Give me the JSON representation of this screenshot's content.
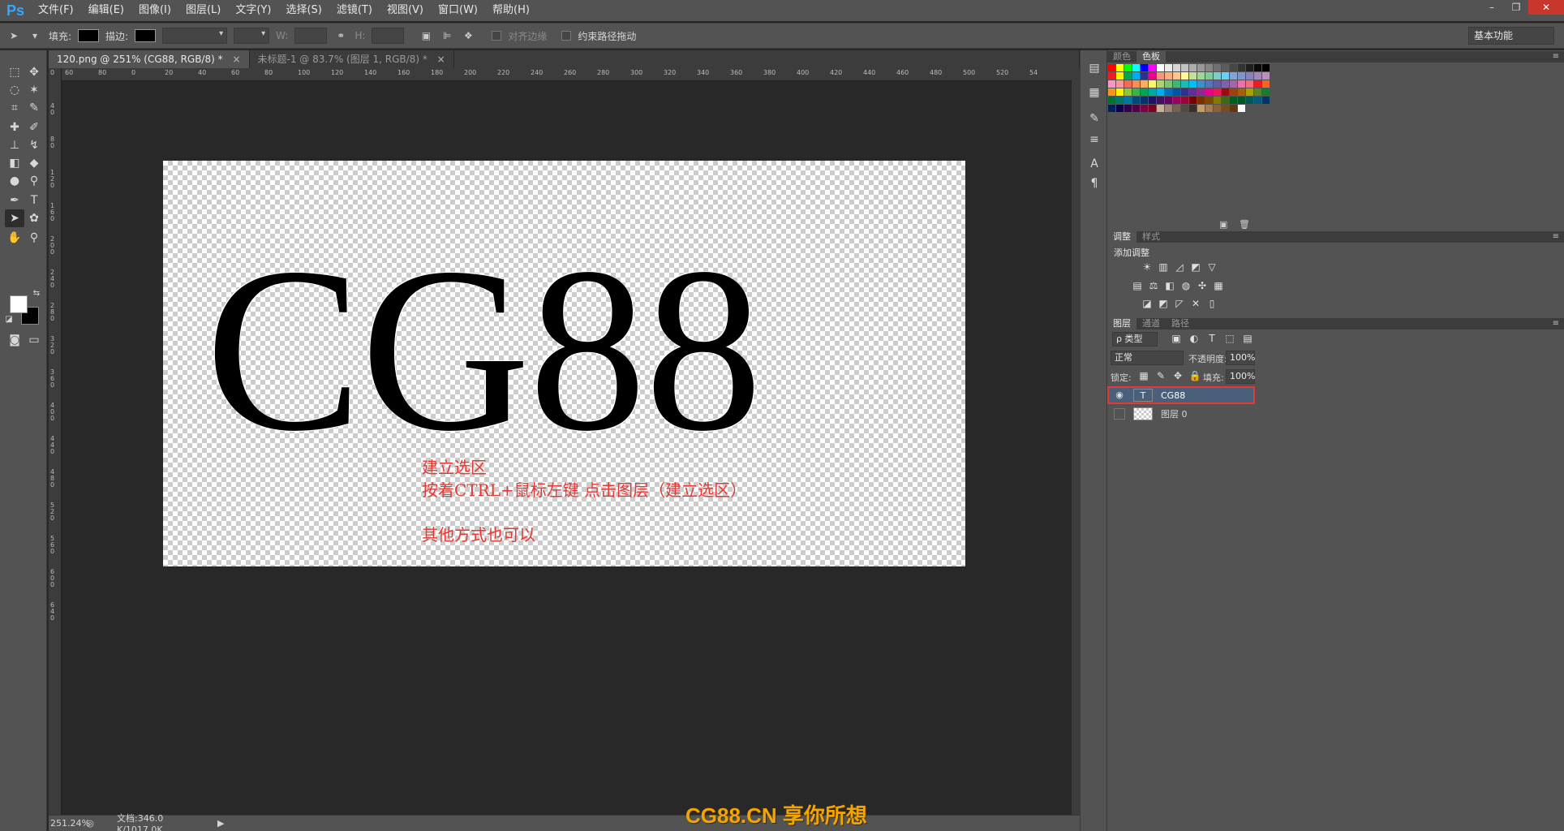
{
  "app": {
    "logo": "Ps"
  },
  "menu": [
    "文件(F)",
    "编辑(E)",
    "图像(I)",
    "图层(L)",
    "文字(Y)",
    "选择(S)",
    "滤镜(T)",
    "视图(V)",
    "窗口(W)",
    "帮助(H)"
  ],
  "window_controls": {
    "minimize": "–",
    "restore": "❐",
    "close": "✕"
  },
  "options": {
    "fill_label": "填充:",
    "stroke_label": "描边:",
    "w_label": "W:",
    "h_label": "H:",
    "align_edges": "对齐边缘",
    "constrain_path": "约束路径拖动",
    "workspace": "基本功能"
  },
  "doc_tabs": [
    {
      "label": "120.png @ 251% (CG88, RGB/8) *",
      "close": "×",
      "active": true
    },
    {
      "label": "未标题-1 @ 83.7% (图层 1, RGB/8) *",
      "close": "×",
      "active": false
    }
  ],
  "ruler_h": [
    "60",
    "80",
    "0",
    "20",
    "40",
    "60",
    "80",
    "100",
    "120",
    "140",
    "160",
    "180",
    "200",
    "220",
    "240",
    "260",
    "280",
    "300",
    "320",
    "340",
    "360",
    "380",
    "400",
    "420",
    "440",
    "460",
    "480",
    "500",
    "520",
    "54"
  ],
  "ruler_v": [
    "0",
    "4 0",
    "8 0",
    "1 2 0",
    "1 6 0",
    "2 0 0",
    "2 4 0",
    "2 8 0",
    "3 2 0",
    "3 6 0",
    "4 0 0",
    "4 4 0",
    "4 8 0",
    "5 2 0",
    "5 6 0",
    "6 0 0",
    "6 4 0"
  ],
  "canvas": {
    "text": "CG88",
    "hint_line1": "建立选区",
    "hint_line2": "按着CTRL+鼠标左键 点击图层（建立选区）",
    "hint_line3": "其他方式也可以"
  },
  "status": {
    "zoom": "251.24%",
    "doc": "文档:346.0 K/1017.0K"
  },
  "watermark": "CG88.CN 享你所想",
  "color_panel": {
    "tab1": "颜色",
    "tab2": "色板"
  },
  "swatch_colors": [
    "#ff0000",
    "#ffff00",
    "#00ff00",
    "#00ffff",
    "#0000ff",
    "#ff00ff",
    "#ffffff",
    "#ebebeb",
    "#d6d6d6",
    "#c2c2c2",
    "#adadad",
    "#999999",
    "#858585",
    "#707070",
    "#5c5c5c",
    "#474747",
    "#333333",
    "#1f1f1f",
    "#0a0a0a",
    "#000000",
    "#ed1c24",
    "#fff200",
    "#00a651",
    "#00aeef",
    "#2e3192",
    "#ec008c",
    "#f7977a",
    "#f9ad81",
    "#fdc68a",
    "#fff79a",
    "#c4df9b",
    "#a3d39c",
    "#82ca9d",
    "#7bcdc8",
    "#6ecff6",
    "#7ea7d8",
    "#8493ca",
    "#8882be",
    "#a187be",
    "#bc8dbf",
    "#f49ac2",
    "#f6989d",
    "#f26c4f",
    "#f68e55",
    "#fbaf5c",
    "#fff467",
    "#acd372",
    "#7cc576",
    "#3bb878",
    "#1abbb4",
    "#00bff3",
    "#438ccb",
    "#5574b9",
    "#605ca8",
    "#855fa8",
    "#a763a8",
    "#f06ea9",
    "#f26d7d",
    "#ed1c24",
    "#f26522",
    "#f7941d",
    "#fff200",
    "#8dc63f",
    "#39b54a",
    "#00a651",
    "#00a99d",
    "#00aeef",
    "#0072bc",
    "#0054a6",
    "#2e3192",
    "#662d91",
    "#92278f",
    "#ec008c",
    "#ed145b",
    "#9e0b0f",
    "#a0410d",
    "#a3620a",
    "#aba000",
    "#598527",
    "#197b30",
    "#007236",
    "#00746b",
    "#0076a3",
    "#004a80",
    "#003471",
    "#1b1464",
    "#440e62",
    "#630460",
    "#9e005d",
    "#9e0039",
    "#790000",
    "#7b2e00",
    "#7d4900",
    "#827b00",
    "#406618",
    "#005e20",
    "#005826",
    "#005952",
    "#005b7f",
    "#003663",
    "#002157",
    "#0d004c",
    "#32004b",
    "#4b0049",
    "#7b0046",
    "#7a0026",
    "#c7b299",
    "#998675",
    "#736357",
    "#534741",
    "#37302a",
    "#c69c6d",
    "#a67c52",
    "#8c6239",
    "#754c24",
    "#603913",
    "#ffffff"
  ],
  "adjust_panel": {
    "tab1": "调整",
    "tab2": "样式",
    "title": "添加调整"
  },
  "layers_panel": {
    "tab1": "图层",
    "tab2": "通道",
    "tab3": "路径",
    "filter": "ρ 类型",
    "blend_mode": "正常",
    "opacity_label": "不透明度:",
    "opacity": "100%",
    "lock_label": "锁定:",
    "fill_label": "填充:",
    "fill": "100%",
    "layers": [
      {
        "name": "CG88",
        "thumb": "T",
        "visible": true,
        "selected": true
      },
      {
        "name": "图层 0",
        "thumb": "",
        "visible": false,
        "selected": false
      }
    ]
  },
  "colors": {
    "selection_highlight": "#e53935",
    "hint_text": "#e53935",
    "accent_watermark": "#f2a400"
  }
}
